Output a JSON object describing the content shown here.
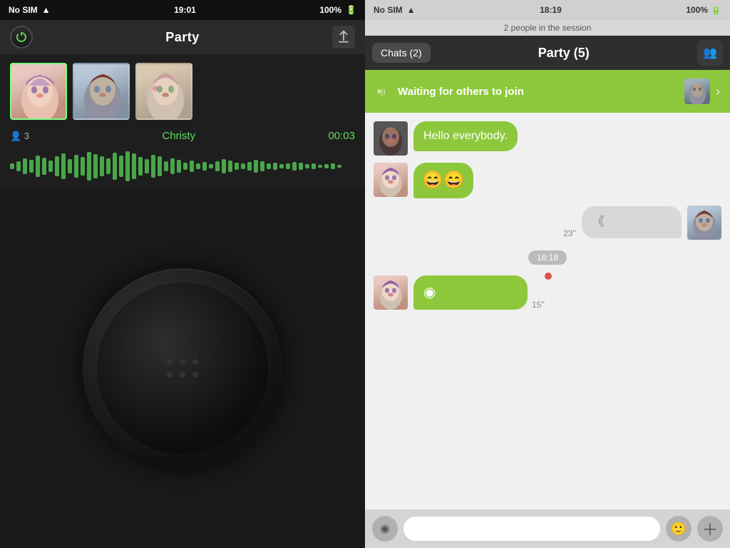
{
  "left": {
    "statusBar": {
      "carrier": "No SIM",
      "time": "19:01",
      "battery": "100%"
    },
    "topBar": {
      "title": "Party",
      "powerLabel": "⏻"
    },
    "participants": [
      {
        "id": 1,
        "type": "woman1",
        "active": true
      },
      {
        "id": 2,
        "type": "man1",
        "active": false
      },
      {
        "id": 3,
        "type": "woman2",
        "active": false
      }
    ],
    "infoRow": {
      "count": "3",
      "activeName": "Christy",
      "timer": "00:03"
    }
  },
  "right": {
    "statusBar": {
      "carrier": "No SIM",
      "time": "18:19",
      "battery": "100%"
    },
    "sessionInfo": "2 people in the session",
    "topBar": {
      "chatsLabel": "Chats (2)",
      "partyLabel": "Party  (5)"
    },
    "waitingBanner": "Waiting for others to join",
    "messages": [
      {
        "id": 1,
        "side": "left",
        "avatarType": "woman3",
        "text": "Hello everybody.",
        "emoji": false,
        "voice": false
      },
      {
        "id": 2,
        "side": "left",
        "avatarType": "woman1",
        "text": "😄😄",
        "emoji": true,
        "voice": false
      },
      {
        "id": 3,
        "side": "right",
        "avatarType": "man2",
        "text": "",
        "emoji": false,
        "voice": true,
        "duration": "23''"
      }
    ],
    "timestampBadge": "18:18",
    "lastMessage": {
      "side": "left",
      "avatarType": "woman1",
      "voice": true,
      "duration": "15''",
      "recording": true
    },
    "inputBar": {
      "placeholder": ""
    }
  }
}
